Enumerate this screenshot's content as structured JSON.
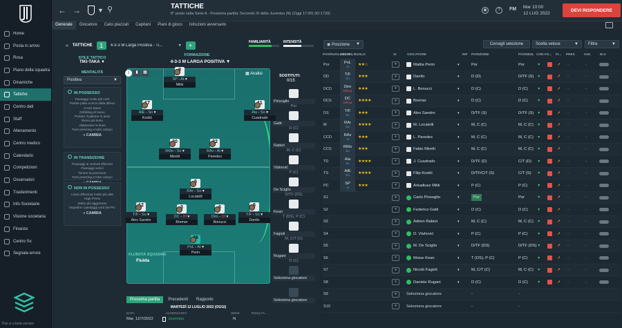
{
  "sidebar": {
    "items": [
      {
        "label": "Home",
        "icon": "home-icon"
      },
      {
        "label": "Posta in arrivo",
        "icon": "inbox-icon"
      },
      {
        "label": "Rosa",
        "icon": "squad-icon"
      },
      {
        "label": "Piano della squadra",
        "icon": "plan-icon"
      },
      {
        "label": "Dinamiche",
        "icon": "dynamics-icon"
      },
      {
        "label": "Tattiche",
        "icon": "tactics-icon",
        "active": true
      },
      {
        "label": "Centro dati",
        "icon": "data-icon"
      },
      {
        "label": "Staff",
        "icon": "staff-icon"
      },
      {
        "label": "Allenamento",
        "icon": "training-icon"
      },
      {
        "label": "Centro medico",
        "icon": "medical-icon"
      },
      {
        "label": "Calendario",
        "icon": "calendar-icon"
      },
      {
        "label": "Competizioni",
        "icon": "trophy-icon"
      },
      {
        "label": "Osservatori",
        "icon": "scout-icon"
      },
      {
        "label": "Trasferimenti",
        "icon": "transfer-icon"
      },
      {
        "label": "Info Societarie",
        "icon": "club-icon"
      },
      {
        "label": "Visione societaria",
        "icon": "vision-icon"
      },
      {
        "label": "Finanze",
        "icon": "finance-icon"
      },
      {
        "label": "Centro Sv.",
        "icon": "development-icon"
      },
      {
        "label": "Segnala errore",
        "icon": "bug-icon"
      }
    ],
    "footer": "This is a beta version"
  },
  "header": {
    "title": "TATTICHE",
    "subtitle": "8° posto nella Serie A - Prossima partita: Secondo XI della Juventus (N) (Oggi 17:00) (ID:1739)",
    "fm_label": "FM",
    "time": "Mar 10:00",
    "date": "12 LUG 2022",
    "respond_label": "DEVI RISPONDERE"
  },
  "tabs": [
    "Generale",
    "Giocatore",
    "Calci piazzati",
    "Capitani",
    "Piani di gioco",
    "Istruzioni avversario"
  ],
  "tactics_bar": {
    "label": "TATTICHE",
    "slot": "1",
    "tactic_name": "4-3-3 M Larga Positiva - Ti...",
    "add": "+",
    "familiarity_label": "FAMILIARITÀ",
    "intensity_label": "INTENSITÀ"
  },
  "style": {
    "label": "STILE TATTICO",
    "value": "TIKI-TAKA"
  },
  "formation": {
    "label": "FORMAZIONE",
    "value": "4-3-3 M LARGA POSITIVA"
  },
  "mentality": {
    "label": "MENTALITÀ",
    "value": "Positiva"
  },
  "analysis_label": "Analisi",
  "phases": [
    {
      "title": "IN POSSESSO",
      "lines": [
        "Passaggi molto più corti",
        "Partire palla a terra dalla difesa",
        "Cross bassi",
        "Dribbling di meno",
        "Portare il pallone in area",
        "Ritmo più lento",
        "Abbassare le linee",
        "Fare pressing a tutto campo"
      ],
      "cambia": "CAMBIA"
    },
    {
      "title": "IN TRANSIZIONE",
      "lines": [
        "Passaggi ai centrali difensivi",
        "Passaggi veloci",
        "Tenere la posizione",
        "Fare pressing a tutto campo"
      ],
      "cambia": "CAMBIA"
    },
    {
      "title": "NON IN POSSESSO",
      "lines": [
        "Linea difensiva molto più alta",
        "High Press",
        "Molto più aggressivi",
        "Impedire i passaggi corti del PO"
      ],
      "cambia": "CAMBIA"
    }
  ],
  "players_on_pitch": [
    {
      "num": "9",
      "role": "SP",
      "duty": "At",
      "name": "Milik"
    },
    {
      "num": "17",
      "role": "AtE",
      "duty": "So",
      "name": "Kostić"
    },
    {
      "num": "11",
      "role": "Ala",
      "duty": "So",
      "name": "Cuadrado"
    },
    {
      "num": "20",
      "role": "RMo",
      "duty": "So",
      "name": "Miretti"
    },
    {
      "num": "32",
      "role": "RAv",
      "duty": "At",
      "name": "Paredes"
    },
    {
      "num": "5",
      "role": "RAr",
      "duty": "So",
      "name": "Locatelli"
    },
    {
      "num": "12",
      "role": "T/F",
      "duty": "So",
      "name": "Alex Sandro"
    },
    {
      "num": "3",
      "role": "DC",
      "duty": "Df",
      "name": "Bremer"
    },
    {
      "num": "6",
      "role": "Dim",
      "duty": "Df",
      "name": "Bonucci"
    },
    {
      "num": "6",
      "role": "T/F",
      "duty": "So",
      "name": "Danilo"
    },
    {
      "num": "36",
      "role": "PoL",
      "duty": "At",
      "name": "Perin"
    }
  ],
  "fluidity": {
    "label": "FLUIDITÀ SQUADRA",
    "value": "Fluida"
  },
  "subs": {
    "label": "SOSTITUTI:",
    "count": "0/15",
    "items": [
      {
        "name": "Pinsoglio",
        "pos": "Por"
      },
      {
        "name": "Gatti",
        "pos": "D (C)"
      },
      {
        "name": "Rabiot",
        "pos": "M, C (C)"
      },
      {
        "name": "Vlahović",
        "pos": "P (C)"
      },
      {
        "name": "De Sciglio",
        "pos": "D/TF (DS)"
      },
      {
        "name": "Kean",
        "pos": "T (DS), P (C)"
      },
      {
        "name": "Fagioli",
        "pos": "M, C/T (C)"
      },
      {
        "name": "Rugani",
        "pos": "D (C)"
      },
      {
        "name": "Seleziona giocatore",
        "pos": ""
      },
      {
        "name": "Seleziona giocatore",
        "pos": ""
      }
    ]
  },
  "match_tabs": [
    "Prossima partita",
    "Precedenti",
    "Rapporto"
  ],
  "match": {
    "date_header": "MARTEDÌ 12 LUGLIO 2022 (OGGI)",
    "cols": [
      "DATA",
      "AVVERSARIO",
      "SEDE",
      "RISULTA..."
    ],
    "date": "Mar, 12/7/2022",
    "opponent": "Juventus",
    "venue": "N"
  },
  "right_toolbar": {
    "position_filter": "Posizione",
    "selection_tips": "Consigli selezione",
    "quick_pick": "Scelta veloce",
    "filter": "Filtra"
  },
  "table_headers": [
    "POS/RUOLO/COM...",
    "ABILITÀ RUOLO",
    "XI",
    "GIOCATORE",
    "INF",
    "POSIZIONE",
    "POS/MIGL",
    "CON",
    "FO...",
    "FI...",
    "PRES",
    "GOL",
    "M.V."
  ],
  "rows": [
    {
      "pos": "Por",
      "role": "PoL",
      "sub": "At",
      "stars": "★★☆",
      "name": "Mattia Perin",
      "position": "Por",
      "best": "Por"
    },
    {
      "pos": "DD",
      "role": "T/F",
      "sub": "So",
      "stars": "★★★",
      "name": "Danilo",
      "position": "D (D)",
      "best": "D/TF (S)"
    },
    {
      "pos": "DCD",
      "role": "Dim",
      "sub": "Difesa",
      "stars": "★★★",
      "name": "L. Bonucci",
      "position": "D (C)",
      "best": "D (C)"
    },
    {
      "pos": "DCS",
      "role": "DC",
      "sub": "Difesa",
      "stars": "★★★★",
      "name": "Bremer",
      "position": "D (C)",
      "best": "D (C)"
    },
    {
      "pos": "DS",
      "role": "T/F",
      "sub": "So",
      "stars": "★★★",
      "name": "Alex Sandro",
      "position": "D/TF (S)",
      "best": "D/TF (S)"
    },
    {
      "pos": "M",
      "role": "RAr",
      "sub": "So",
      "stars": "★★★★",
      "name": "M. Locatelli",
      "position": "M, C (C)",
      "best": "M, C (C)"
    },
    {
      "pos": "CCD",
      "role": "RAv",
      "sub": "At",
      "stars": "★★★",
      "name": "L. Paredes",
      "position": "M, C (C)",
      "best": "M, C (C)"
    },
    {
      "pos": "CCS",
      "role": "RMo",
      "sub": "So",
      "stars": "★★★",
      "name": "Fabio Miretti",
      "position": "M, C (C)",
      "best": "M, C (C)"
    },
    {
      "pos": "TD",
      "role": "Ala",
      "sub": "So",
      "stars": "★★★★",
      "name": "J. Cuadrado",
      "position": "D/TF (D)",
      "best": "C/T (D)"
    },
    {
      "pos": "TS",
      "role": "AtE",
      "sub": "So",
      "stars": "★★★★",
      "name": "Filip Kostić",
      "position": "D/TF/C/T (S)",
      "best": "C/T (S)"
    },
    {
      "pos": "PC",
      "role": "SP",
      "sub": "At",
      "stars": "★★★",
      "name": "Arkadiusz Milik",
      "position": "P (C)",
      "best": "P (C)"
    },
    {
      "pos": "S1",
      "role": "",
      "sub": "",
      "stars": "",
      "name": "Carlo Pinsoglio",
      "position": "Por",
      "best": "Por"
    },
    {
      "pos": "S2",
      "role": "",
      "sub": "",
      "stars": "",
      "name": "Federico Gatti",
      "position": "D (C)",
      "best": "D (C)"
    },
    {
      "pos": "S3",
      "role": "",
      "sub": "",
      "stars": "",
      "name": "Adrien Rabiot",
      "position": "M, C (C)",
      "best": "M, C (C)"
    },
    {
      "pos": "S4",
      "role": "",
      "sub": "",
      "stars": "",
      "name": "D. Vlahović",
      "position": "P (C)",
      "best": "P (C)"
    },
    {
      "pos": "S5",
      "role": "",
      "sub": "",
      "stars": "",
      "name": "M. De Sciglio",
      "position": "D/TF (DS)",
      "best": "D/TF (DS)"
    },
    {
      "pos": "S6",
      "role": "",
      "sub": "",
      "stars": "",
      "name": "Moise Kean",
      "position": "T (DS), P (C)",
      "best": "P (C)"
    },
    {
      "pos": "S7",
      "role": "",
      "sub": "",
      "stars": "",
      "name": "Nicolò Fagioli",
      "position": "M, C/T (C)",
      "best": "M, C (C)"
    },
    {
      "pos": "S8",
      "role": "",
      "sub": "",
      "stars": "",
      "name": "Daniele Rugani",
      "position": "D (C)",
      "best": "D (C)"
    },
    {
      "pos": "S9",
      "role": "",
      "sub": "",
      "stars": "",
      "name": "Seleziona giocatore",
      "position": "-",
      "best": "-"
    },
    {
      "pos": "S10",
      "role": "",
      "sub": "",
      "stars": "",
      "name": "Seleziona giocatore",
      "position": "-",
      "best": "-"
    }
  ],
  "colors": {
    "accent": "#2fa37d",
    "alert": "#d9443d",
    "star": "#f3c21a"
  }
}
